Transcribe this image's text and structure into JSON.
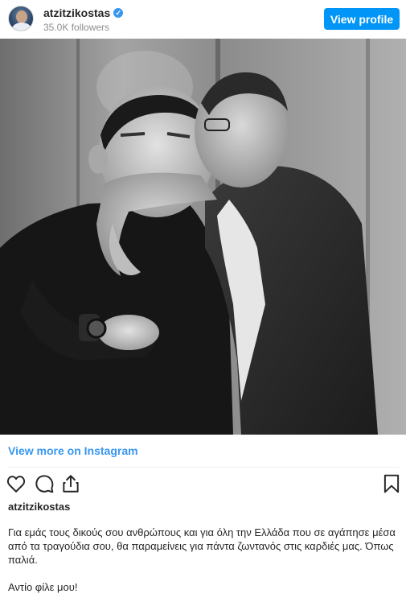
{
  "header": {
    "username": "atzitzikostas",
    "followers": "35.0K followers",
    "view_profile_label": "View profile",
    "verified_icon": "check-badge-icon"
  },
  "post": {
    "image_icon": "photo",
    "view_more_label": "View more on Instagram",
    "caption_user": "atzitzikostas",
    "caption": "Για εμάς τους δικούς σου ανθρώπους και για όλη την Ελλάδα που σε αγάπησε μέσα από τα τραγούδια σου, θα παραμείνεις για πάντα ζωντανός στις καρδιές μας. Όπως παλιά.",
    "caption_end": "Αντίο φίλε μου!"
  },
  "actions": {
    "like": "heart-icon",
    "comment": "comment-icon",
    "share": "share-icon",
    "save": "bookmark-icon"
  },
  "colors": {
    "accent": "#0095f6",
    "link": "#3897f0",
    "verified": "#3897f0",
    "text": "#262626",
    "muted": "#8e8e8e"
  }
}
